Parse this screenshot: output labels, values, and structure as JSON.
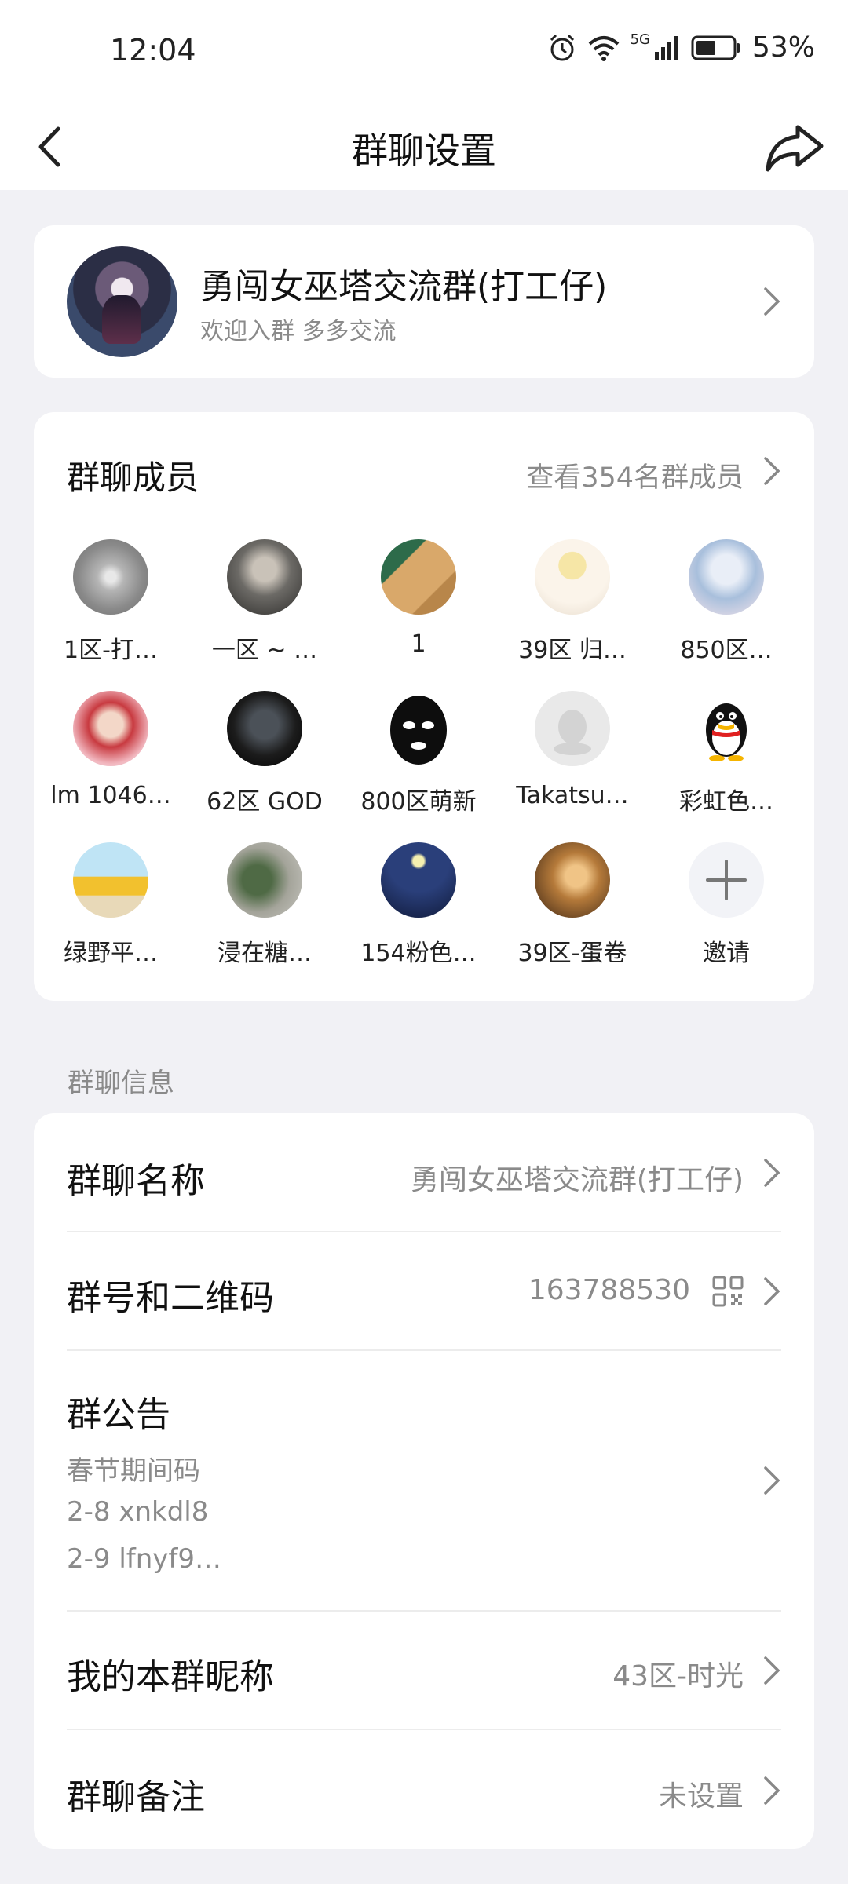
{
  "status_bar": {
    "time": "12:04",
    "network": "5G",
    "battery": "53%",
    "icons": [
      "alarm-icon",
      "wifi-icon",
      "signal-icon",
      "battery-icon"
    ]
  },
  "nav": {
    "title": "群聊设置",
    "back_icon": "chevron-left-icon",
    "share_icon": "share-icon"
  },
  "group": {
    "name": "勇闯女巫塔交流群(打工仔)",
    "description": "欢迎入群 多多交流"
  },
  "members": {
    "title": "群聊成员",
    "view_all": "查看354名群成员",
    "list": [
      {
        "name": "1区-打…",
        "color": "#9a9a9a"
      },
      {
        "name": "一区 ~ …",
        "color": "#6c6a66"
      },
      {
        "name": "1",
        "color": "#b8864a"
      },
      {
        "name": "39区 归…",
        "color": "#f2e3c8"
      },
      {
        "name": "850区…",
        "color": "#cfe0f0"
      },
      {
        "name": "lm 1046…",
        "color": "#d7484c"
      },
      {
        "name": "62区 GOD",
        "color": "#151515"
      },
      {
        "name": "800区萌新",
        "color": "#0d0d0d"
      },
      {
        "name": "Takatsu…",
        "color": "#e4e4e4"
      },
      {
        "name": "彩虹色…",
        "color": "#ffffff"
      },
      {
        "name": "绿野平…",
        "color": "#7ec6e8"
      },
      {
        "name": "浸在糖…",
        "color": "#7e8c78"
      },
      {
        "name": "154粉色…",
        "color": "#1a2a5a"
      },
      {
        "name": "39区-蛋卷",
        "color": "#8a5a2e"
      },
      {
        "name": "邀请",
        "color": "#f2f3f7"
      }
    ]
  },
  "info_section": {
    "label": "群聊信息",
    "group_name_label": "群聊名称",
    "group_name_value": "勇闯女巫塔交流群(打工仔)",
    "group_id_label": "群号和二维码",
    "group_id_value": "163788530",
    "notice_label": "群公告",
    "notice_lines": [
      "春节期间码",
      "2-8 xnkdl8",
      "2-9 lfnyf9…"
    ],
    "nickname_label": "我的本群昵称",
    "nickname_value": "43区-时光",
    "remark_label": "群聊备注",
    "remark_value": "未设置"
  }
}
